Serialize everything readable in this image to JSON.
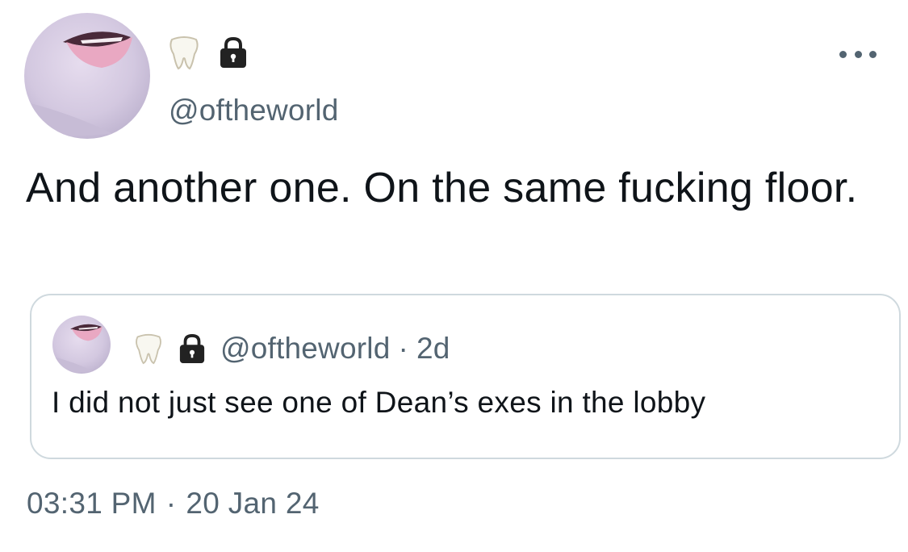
{
  "tweet": {
    "author": {
      "display_name_icons": [
        "tooth-icon",
        "lock-icon"
      ],
      "handle": "@oftheworld"
    },
    "text": "And another one. On the same fucking floor.",
    "menu_icon": "more-options-icon",
    "time": "03:31 PM",
    "separator": "·",
    "date": "20 Jan 24"
  },
  "quoted_tweet": {
    "author": {
      "display_name_icons": [
        "tooth-icon",
        "lock-icon"
      ],
      "handle": "@oftheworld"
    },
    "separator": "·",
    "age": "2d",
    "text": "I did not just see one of Dean’s exes in the lobby"
  },
  "colors": {
    "primary_text": "#0f1419",
    "secondary_text": "#536471",
    "border": "#cfd9de"
  }
}
